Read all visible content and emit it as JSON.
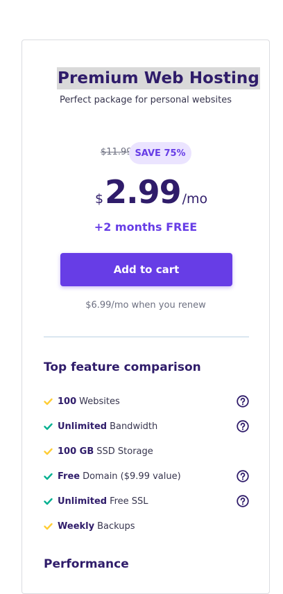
{
  "plan": {
    "title": "Premium Web Hosting",
    "subtitle": "Perfect package for personal websites"
  },
  "pricing": {
    "old_price": "$11.99",
    "save_badge": "SAVE 75%",
    "currency": "$",
    "amount": "2.99",
    "period": "/mo",
    "promo": "+2 months FREE",
    "cta_label": "Add to cart",
    "renew_note": "$6.99/mo when you renew"
  },
  "features": {
    "heading": "Top feature comparison",
    "items": [
      {
        "bold": "100",
        "text": "Websites",
        "check_color": "#ffcd35",
        "help": true
      },
      {
        "bold": "Unlimited",
        "text": "Bandwidth",
        "check_color": "#00b090",
        "help": true
      },
      {
        "bold": "100 GB",
        "text": "SSD Storage",
        "check_color": "#ffcd35",
        "help": false
      },
      {
        "bold": "Free",
        "text": "Domain ($9.99 value)",
        "check_color": "#00b090",
        "help": true
      },
      {
        "bold": "Unlimited",
        "text": "Free SSL",
        "check_color": "#00b090",
        "help": true
      },
      {
        "bold": "Weekly",
        "text": "Backups",
        "check_color": "#ffcd35",
        "help": false
      }
    ]
  },
  "performance": {
    "heading": "Performance"
  },
  "colors": {
    "accent": "#673de6",
    "heading": "#2f1c6a",
    "check_yellow": "#ffcd35",
    "check_green": "#00b090"
  }
}
